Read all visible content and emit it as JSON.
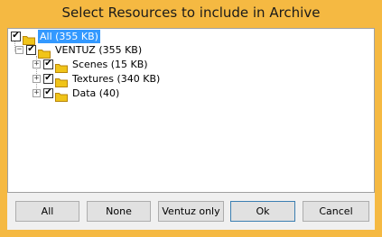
{
  "window": {
    "title": "Select Resources to include in Archive"
  },
  "tree": {
    "root": {
      "label": "All (355 KB)",
      "checked": "✔"
    },
    "ventuz": {
      "label": "VENTUZ (355 KB)",
      "checked": "✔",
      "expander": "−"
    },
    "children": [
      {
        "label": "Scenes (15 KB)",
        "checked": "✔",
        "expander": "+"
      },
      {
        "label": "Textures (340 KB)",
        "checked": "✔",
        "expander": "+"
      },
      {
        "label": "Data (40)",
        "checked": "✔",
        "expander": "+"
      }
    ]
  },
  "buttons": {
    "all": "All",
    "none": "None",
    "ventuz_only": "Ventuz only",
    "ok": "Ok",
    "cancel": "Cancel"
  },
  "colors": {
    "frame": "#f5b942",
    "selection": "#3399ff",
    "folder": "#f0c419"
  }
}
